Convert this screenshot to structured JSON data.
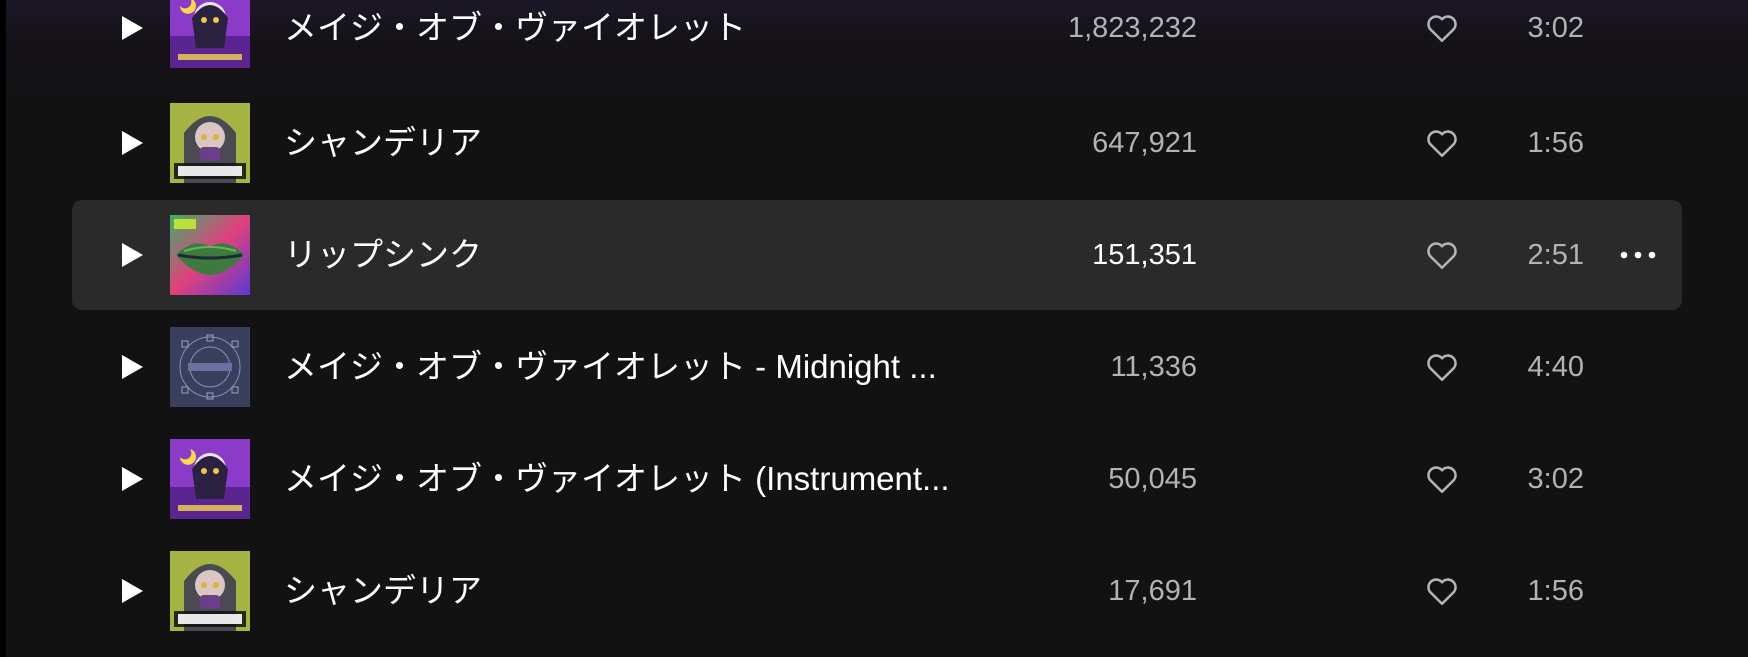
{
  "tracks": [
    {
      "title": "メイジ・オブ・ヴァイオレット",
      "plays": "1,823,232",
      "duration": "3:02",
      "art": "mage-violet-cover",
      "hovered": false
    },
    {
      "title": "シャンデリア",
      "plays": "647,921",
      "duration": "1:56",
      "art": "chandelier-cover",
      "hovered": false
    },
    {
      "title": "リップシンク",
      "plays": "151,351",
      "duration": "2:51",
      "art": "lipsync-cover",
      "hovered": true
    },
    {
      "title": "メイジ・オブ・ヴァイオレット - Midnight ...",
      "plays": "11,336",
      "duration": "4:40",
      "art": "midnight-cover",
      "hovered": false
    },
    {
      "title": "メイジ・オブ・ヴァイオレット (Instrument...",
      "plays": "50,045",
      "duration": "3:02",
      "art": "mage-violet-cover",
      "hovered": false
    },
    {
      "title": "シャンデリア",
      "plays": "17,691",
      "duration": "1:56",
      "art": "chandelier-cover",
      "hovered": false
    }
  ],
  "icons": {
    "play": "play-icon",
    "like": "heart-outline-icon",
    "more": "more-options-icon"
  },
  "colors": {
    "background": "#121212",
    "row_hover": "#2a2a2a",
    "text_primary": "#ffffff",
    "text_secondary": "#b3b3b3"
  }
}
